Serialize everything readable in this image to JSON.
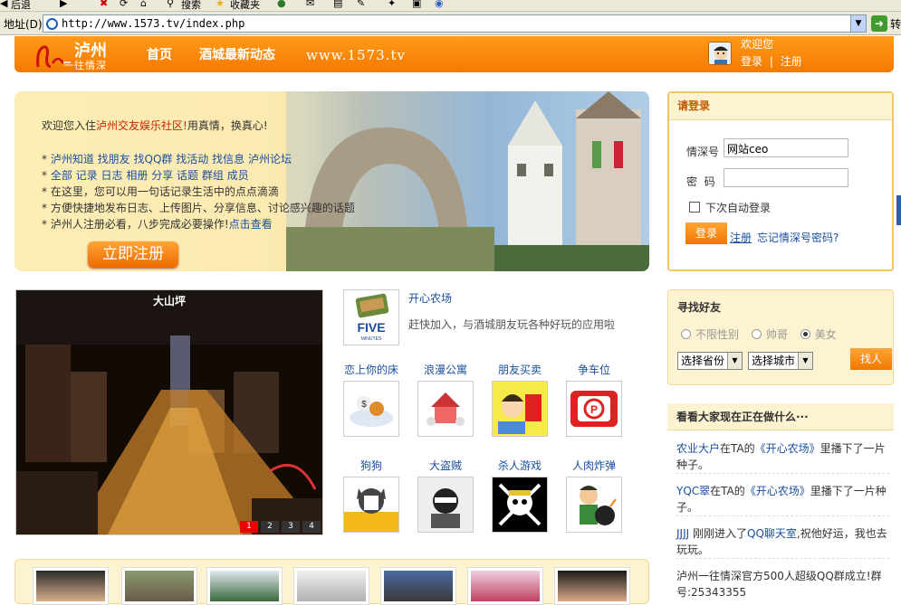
{
  "browser": {
    "toolbar": {
      "back": "后退",
      "search": "搜索",
      "favorites": "收藏夹"
    },
    "address": {
      "label": "地址(D)",
      "url": "http://www.1573.tv/index.php",
      "go": "转"
    }
  },
  "nav": {
    "logo_main": "泸州",
    "logo_sub": "一往情深",
    "items": [
      "首页",
      "酒城最新动态"
    ],
    "site_url": "www.1573.tv",
    "welcome": "欢迎您",
    "login": "登录",
    "sep": "|",
    "register": "注册"
  },
  "banner": {
    "intro_pre": "欢迎您入住",
    "intro_hl": "泸州交友娱乐社区!",
    "intro_post": "用真情，换真心!",
    "line1": [
      "泸州知道",
      "找朋友",
      "找QQ群",
      "找活动",
      "找信息",
      "泸州论坛"
    ],
    "line2": [
      "全部",
      "记录",
      "日志",
      "相册",
      "分享",
      "话题",
      "群组",
      "成员"
    ],
    "line3": "在这里，您可以用一句话记录生活中的点点滴滴",
    "line4": "方便快捷地发布日志、上传图片、分享信息、讨论感兴趣的话题",
    "line5_pre": "泸州人注册必看，八步完成必要操作!",
    "line5_link": "点击查看",
    "register_button": "立即注册"
  },
  "login": {
    "title": "请登录",
    "user_label": "情深号",
    "user_value": "网站ceo",
    "pass_label": "密  码",
    "remember": "下次自动登录",
    "login_button": "登录",
    "register_link": "注册",
    "forgot_link": "忘记情深号密码?"
  },
  "slideshow": {
    "caption": "大山坪",
    "pages": [
      "1",
      "2",
      "3",
      "4"
    ],
    "current": 1
  },
  "apps": {
    "featured": {
      "title": "开心农场",
      "desc": "赶快加入，与酒城朋友玩各种好玩的应用啦",
      "logo_text": "FIVE",
      "logo_sub": "MINUTES"
    },
    "row1": [
      "恋上你的床",
      "浪漫公寓",
      "朋友买卖",
      "争车位"
    ],
    "row2": [
      "狗狗",
      "大盗贼",
      "杀人游戏",
      "人肉炸弹"
    ]
  },
  "friend_search": {
    "title": "寻找好友",
    "options": [
      "不限性别",
      "帅哥",
      "美女"
    ],
    "selected": 2,
    "province": "选择省份",
    "city": "选择城市",
    "button": "找人"
  },
  "feed": {
    "title": "看看大家现在正在做什么···",
    "items": [
      {
        "user": "农业大户",
        "mid": "在TA的",
        "link": "《开心农场》",
        "post": "里播下了一片种子。"
      },
      {
        "user": "YQC翠",
        "mid": "在TA的",
        "link": "《开心农场》",
        "post": "里播下了一片种子。"
      },
      {
        "user": "JJJJ",
        "mid": "刚刚进入了",
        "link": "QQ聊天室",
        "post": ",祝他好运，我也去玩玩。"
      },
      {
        "user": "",
        "mid": "泸州一往情深官方500人超级QQ群成立!群号:25343355",
        "link": "",
        "post": ""
      }
    ]
  },
  "colors": {
    "brand_orange": "#f47a00",
    "link_blue": "#1a4fa0",
    "panel_cream": "#fdf3d0",
    "highlight_red": "#cc2200"
  }
}
